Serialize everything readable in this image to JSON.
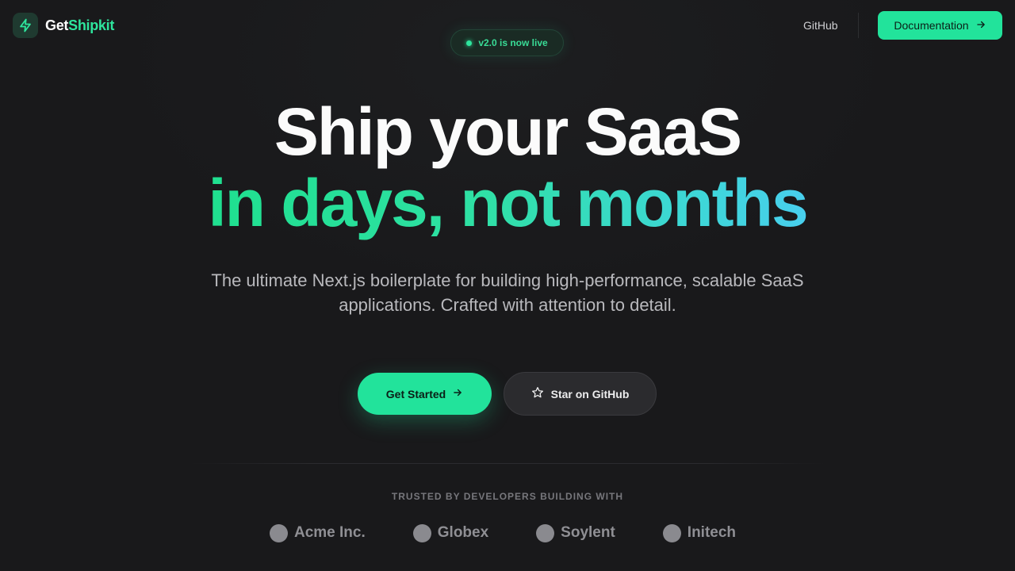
{
  "header": {
    "brand_part1": "Get",
    "brand_part2": "Shipkit",
    "nav_github": "GitHub",
    "docs_button": "Documentation"
  },
  "badge": {
    "text": "v2.0 is now live"
  },
  "hero": {
    "title_line1": "Ship your SaaS",
    "title_line2": "in days, not months",
    "subtitle": "The ultimate Next.js boilerplate for building high-performance, scalable SaaS applications. Crafted with attention to detail."
  },
  "cta": {
    "primary": "Get Started",
    "secondary": "Star on GitHub"
  },
  "trusted": {
    "label": "TRUSTED BY DEVELOPERS BUILDING WITH",
    "logos": [
      "Acme Inc.",
      "Globex",
      "Soylent",
      "Initech"
    ]
  },
  "colors": {
    "accent": "#22e39b",
    "gradient_end": "#48cfee",
    "background": "#19191b"
  },
  "icons": {
    "brand": "lightning-bolt-icon",
    "docs_arrow": "arrow-right-icon",
    "cta_arrow": "arrow-right-icon",
    "star": "star-icon"
  }
}
